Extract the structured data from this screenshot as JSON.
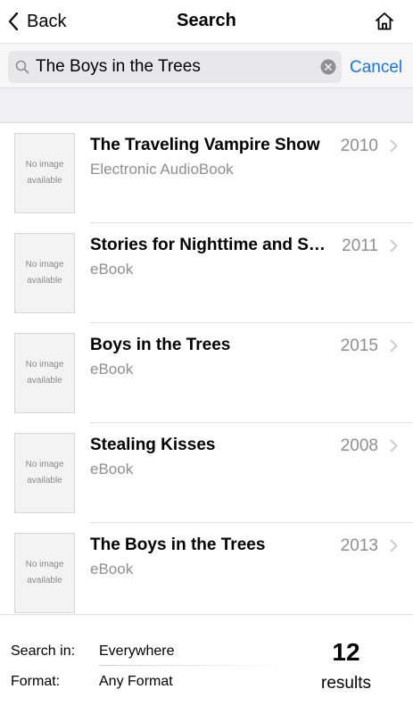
{
  "nav": {
    "back_label": "Back",
    "title": "Search",
    "home_icon": "home-icon"
  },
  "search": {
    "query": "The Boys in the Trees",
    "cancel_label": "Cancel"
  },
  "thumbnail_placeholder": {
    "line1": "No image",
    "line2": "available"
  },
  "results": [
    {
      "title": "The Traveling Vampire Show",
      "format": "Electronic AudioBook",
      "year": "2010"
    },
    {
      "title": "Stories for Nighttime and Some for the Day",
      "format": "eBook",
      "year": "2011"
    },
    {
      "title": "Boys in the Trees",
      "format": "eBook",
      "year": "2015"
    },
    {
      "title": "Stealing Kisses",
      "format": "eBook",
      "year": "2008"
    },
    {
      "title": "The Boys in the Trees",
      "format": "eBook",
      "year": "2013"
    }
  ],
  "footer": {
    "search_in_label": "Search in:",
    "search_in_value": "Everywhere",
    "format_label": "Format:",
    "format_value": "Any Format",
    "result_count": "12",
    "results_label": "results"
  },
  "colors": {
    "accent": "#1a73e8",
    "secondary_text": "#8e8e93"
  }
}
